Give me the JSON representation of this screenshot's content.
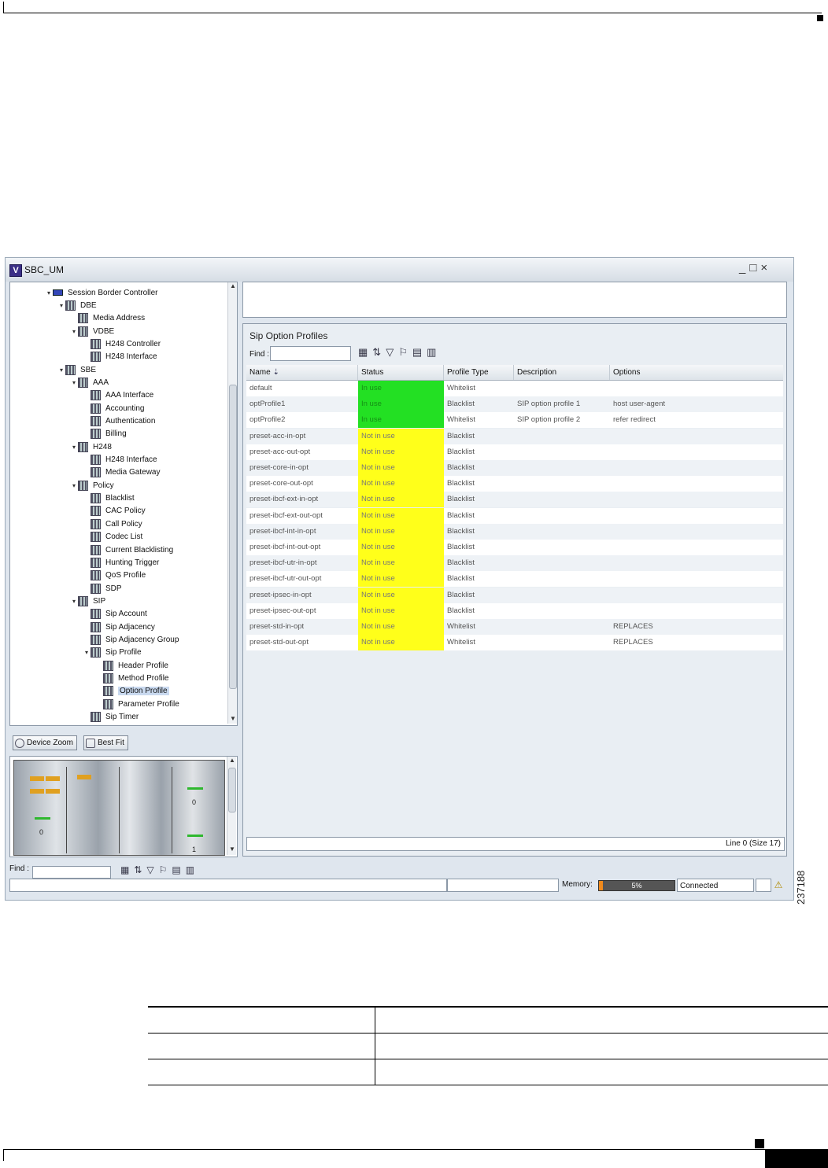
{
  "figure_id": "237188",
  "window": {
    "title": "SBC_UM",
    "app_icon": "V",
    "controls": [
      "_",
      "□",
      "×"
    ]
  },
  "tree": {
    "items": [
      {
        "label": "Session Border Controller",
        "level": 0,
        "expanded": true,
        "kind": "root"
      },
      {
        "label": "DBE",
        "level": 1,
        "expanded": true
      },
      {
        "label": "Media Address",
        "level": 2
      },
      {
        "label": "VDBE",
        "level": 2,
        "expanded": true
      },
      {
        "label": "H248 Controller",
        "level": 3
      },
      {
        "label": "H248 Interface",
        "level": 3
      },
      {
        "label": "SBE",
        "level": 1,
        "expanded": true
      },
      {
        "label": "AAA",
        "level": 2,
        "expanded": true
      },
      {
        "label": "AAA Interface",
        "level": 3
      },
      {
        "label": "Accounting",
        "level": 3
      },
      {
        "label": "Authentication",
        "level": 3
      },
      {
        "label": "Billing",
        "level": 3
      },
      {
        "label": "H248",
        "level": 2,
        "expanded": true
      },
      {
        "label": "H248 Interface",
        "level": 3
      },
      {
        "label": "Media Gateway",
        "level": 3
      },
      {
        "label": "Policy",
        "level": 2,
        "expanded": true
      },
      {
        "label": "Blacklist",
        "level": 3
      },
      {
        "label": "CAC Policy",
        "level": 3
      },
      {
        "label": "Call Policy",
        "level": 3
      },
      {
        "label": "Codec List",
        "level": 3
      },
      {
        "label": "Current Blacklisting",
        "level": 3
      },
      {
        "label": "Hunting Trigger",
        "level": 3
      },
      {
        "label": "QoS Profile",
        "level": 3
      },
      {
        "label": "SDP",
        "level": 3
      },
      {
        "label": "SIP",
        "level": 2,
        "expanded": true
      },
      {
        "label": "Sip Account",
        "level": 3
      },
      {
        "label": "Sip Adjacency",
        "level": 3
      },
      {
        "label": "Sip Adjacency Group",
        "level": 3
      },
      {
        "label": "Sip Profile",
        "level": 3,
        "expanded": true
      },
      {
        "label": "Header Profile",
        "level": 4
      },
      {
        "label": "Method Profile",
        "level": 4
      },
      {
        "label": "Option Profile",
        "level": 4,
        "selected": true
      },
      {
        "label": "Parameter Profile",
        "level": 4
      },
      {
        "label": "Sip Timer",
        "level": 3
      }
    ]
  },
  "zoom_buttons": {
    "device_zoom": "Device Zoom",
    "best_fit": "Best Fit"
  },
  "device": {
    "card_labels": [
      "0",
      "0",
      "1"
    ]
  },
  "left_find": {
    "label": "Find :",
    "value": ""
  },
  "status": {
    "memory_label": "Memory:",
    "memory_percent": 5,
    "memory_text": "5%",
    "connection": "Connected"
  },
  "main": {
    "section_title": "Sip Option Profiles",
    "find_label": "Find :",
    "find_value": "",
    "columns": [
      "Name",
      "Status",
      "Profile Type",
      "Description",
      "Options"
    ],
    "rows": [
      {
        "name": "default",
        "status": "In use",
        "type": "Whitelist",
        "description": "",
        "options": ""
      },
      {
        "name": "optProfile1",
        "status": "In use",
        "type": "Blacklist",
        "description": "SIP option profile 1",
        "options": "host user-agent"
      },
      {
        "name": "optProfile2",
        "status": "In use",
        "type": "Whitelist",
        "description": "SIP option profile 2",
        "options": "refer redirect"
      },
      {
        "name": "preset-acc-in-opt",
        "status": "Not in use",
        "type": "Blacklist",
        "description": "",
        "options": ""
      },
      {
        "name": "preset-acc-out-opt",
        "status": "Not in use",
        "type": "Blacklist",
        "description": "",
        "options": ""
      },
      {
        "name": "preset-core-in-opt",
        "status": "Not in use",
        "type": "Blacklist",
        "description": "",
        "options": ""
      },
      {
        "name": "preset-core-out-opt",
        "status": "Not in use",
        "type": "Blacklist",
        "description": "",
        "options": ""
      },
      {
        "name": "preset-ibcf-ext-in-opt",
        "status": "Not in use",
        "type": "Blacklist",
        "description": "",
        "options": ""
      },
      {
        "name": "preset-ibcf-ext-out-opt",
        "status": "Not in use",
        "type": "Blacklist",
        "description": "",
        "options": ""
      },
      {
        "name": "preset-ibcf-int-in-opt",
        "status": "Not in use",
        "type": "Blacklist",
        "description": "",
        "options": ""
      },
      {
        "name": "preset-ibcf-int-out-opt",
        "status": "Not in use",
        "type": "Blacklist",
        "description": "",
        "options": ""
      },
      {
        "name": "preset-ibcf-utr-in-opt",
        "status": "Not in use",
        "type": "Blacklist",
        "description": "",
        "options": ""
      },
      {
        "name": "preset-ibcf-utr-out-opt",
        "status": "Not in use",
        "type": "Blacklist",
        "description": "",
        "options": ""
      },
      {
        "name": "preset-ipsec-in-opt",
        "status": "Not in use",
        "type": "Blacklist",
        "description": "",
        "options": ""
      },
      {
        "name": "preset-ipsec-out-opt",
        "status": "Not in use",
        "type": "Blacklist",
        "description": "",
        "options": ""
      },
      {
        "name": "preset-std-in-opt",
        "status": "Not in use",
        "type": "Whitelist",
        "description": "",
        "options": "REPLACES"
      },
      {
        "name": "preset-std-out-opt",
        "status": "Not in use",
        "type": "Whitelist",
        "description": "",
        "options": "REPLACES"
      }
    ],
    "line_info": "Line 0 (Size 17)"
  },
  "colors": {
    "in_use": "#23e023",
    "not_in_use": "#ffff1a",
    "selection": "#c9d9ef"
  }
}
